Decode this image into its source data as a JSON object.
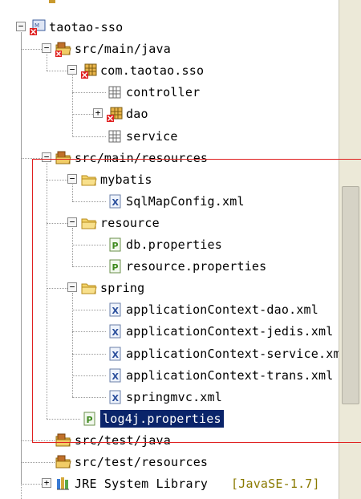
{
  "tree": {
    "items": [
      {
        "label": "taotao-sso",
        "icon": "project-error-icon",
        "toggle": "−"
      },
      {
        "label": "src/main/java",
        "icon": "source-folder-error-icon",
        "toggle": "−"
      },
      {
        "label": "com.taotao.sso",
        "icon": "package-error-icon",
        "toggle": "−"
      },
      {
        "label": "controller",
        "icon": "package-icon",
        "toggle": ""
      },
      {
        "label": "dao",
        "icon": "package-error-icon",
        "toggle": "+"
      },
      {
        "label": "service",
        "icon": "package-icon",
        "toggle": ""
      },
      {
        "label": "src/main/resources",
        "icon": "source-folder-icon",
        "toggle": "−"
      },
      {
        "label": "mybatis",
        "icon": "folder-icon",
        "toggle": "−"
      },
      {
        "label": "SqlMapConfig.xml",
        "icon": "xml-file-icon",
        "toggle": ""
      },
      {
        "label": "resource",
        "icon": "folder-icon",
        "toggle": "−"
      },
      {
        "label": "db.properties",
        "icon": "properties-file-icon",
        "toggle": ""
      },
      {
        "label": "resource.properties",
        "icon": "properties-file-icon",
        "toggle": ""
      },
      {
        "label": "spring",
        "icon": "folder-icon",
        "toggle": "−"
      },
      {
        "label": "applicationContext-dao.xml",
        "icon": "xml-file-icon",
        "toggle": ""
      },
      {
        "label": "applicationContext-jedis.xml",
        "icon": "xml-file-icon",
        "toggle": ""
      },
      {
        "label": "applicationContext-service.xml",
        "icon": "xml-file-icon",
        "toggle": ""
      },
      {
        "label": "applicationContext-trans.xml",
        "icon": "xml-file-icon",
        "toggle": ""
      },
      {
        "label": "springmvc.xml",
        "icon": "xml-file-icon",
        "toggle": ""
      },
      {
        "label": "log4j.properties",
        "icon": "properties-file-icon",
        "toggle": "",
        "selected": true
      },
      {
        "label": "src/test/java",
        "icon": "source-folder-icon",
        "toggle": ""
      },
      {
        "label": "src/test/resources",
        "icon": "source-folder-icon",
        "toggle": ""
      },
      {
        "label": "JRE System Library",
        "suffix": "[JavaSE-1.7]",
        "icon": "library-icon",
        "toggle": "+"
      }
    ]
  },
  "colors": {
    "selection": "#0a246a",
    "highlight_box": "#e02020",
    "library_suffix": "#8a7a00"
  }
}
